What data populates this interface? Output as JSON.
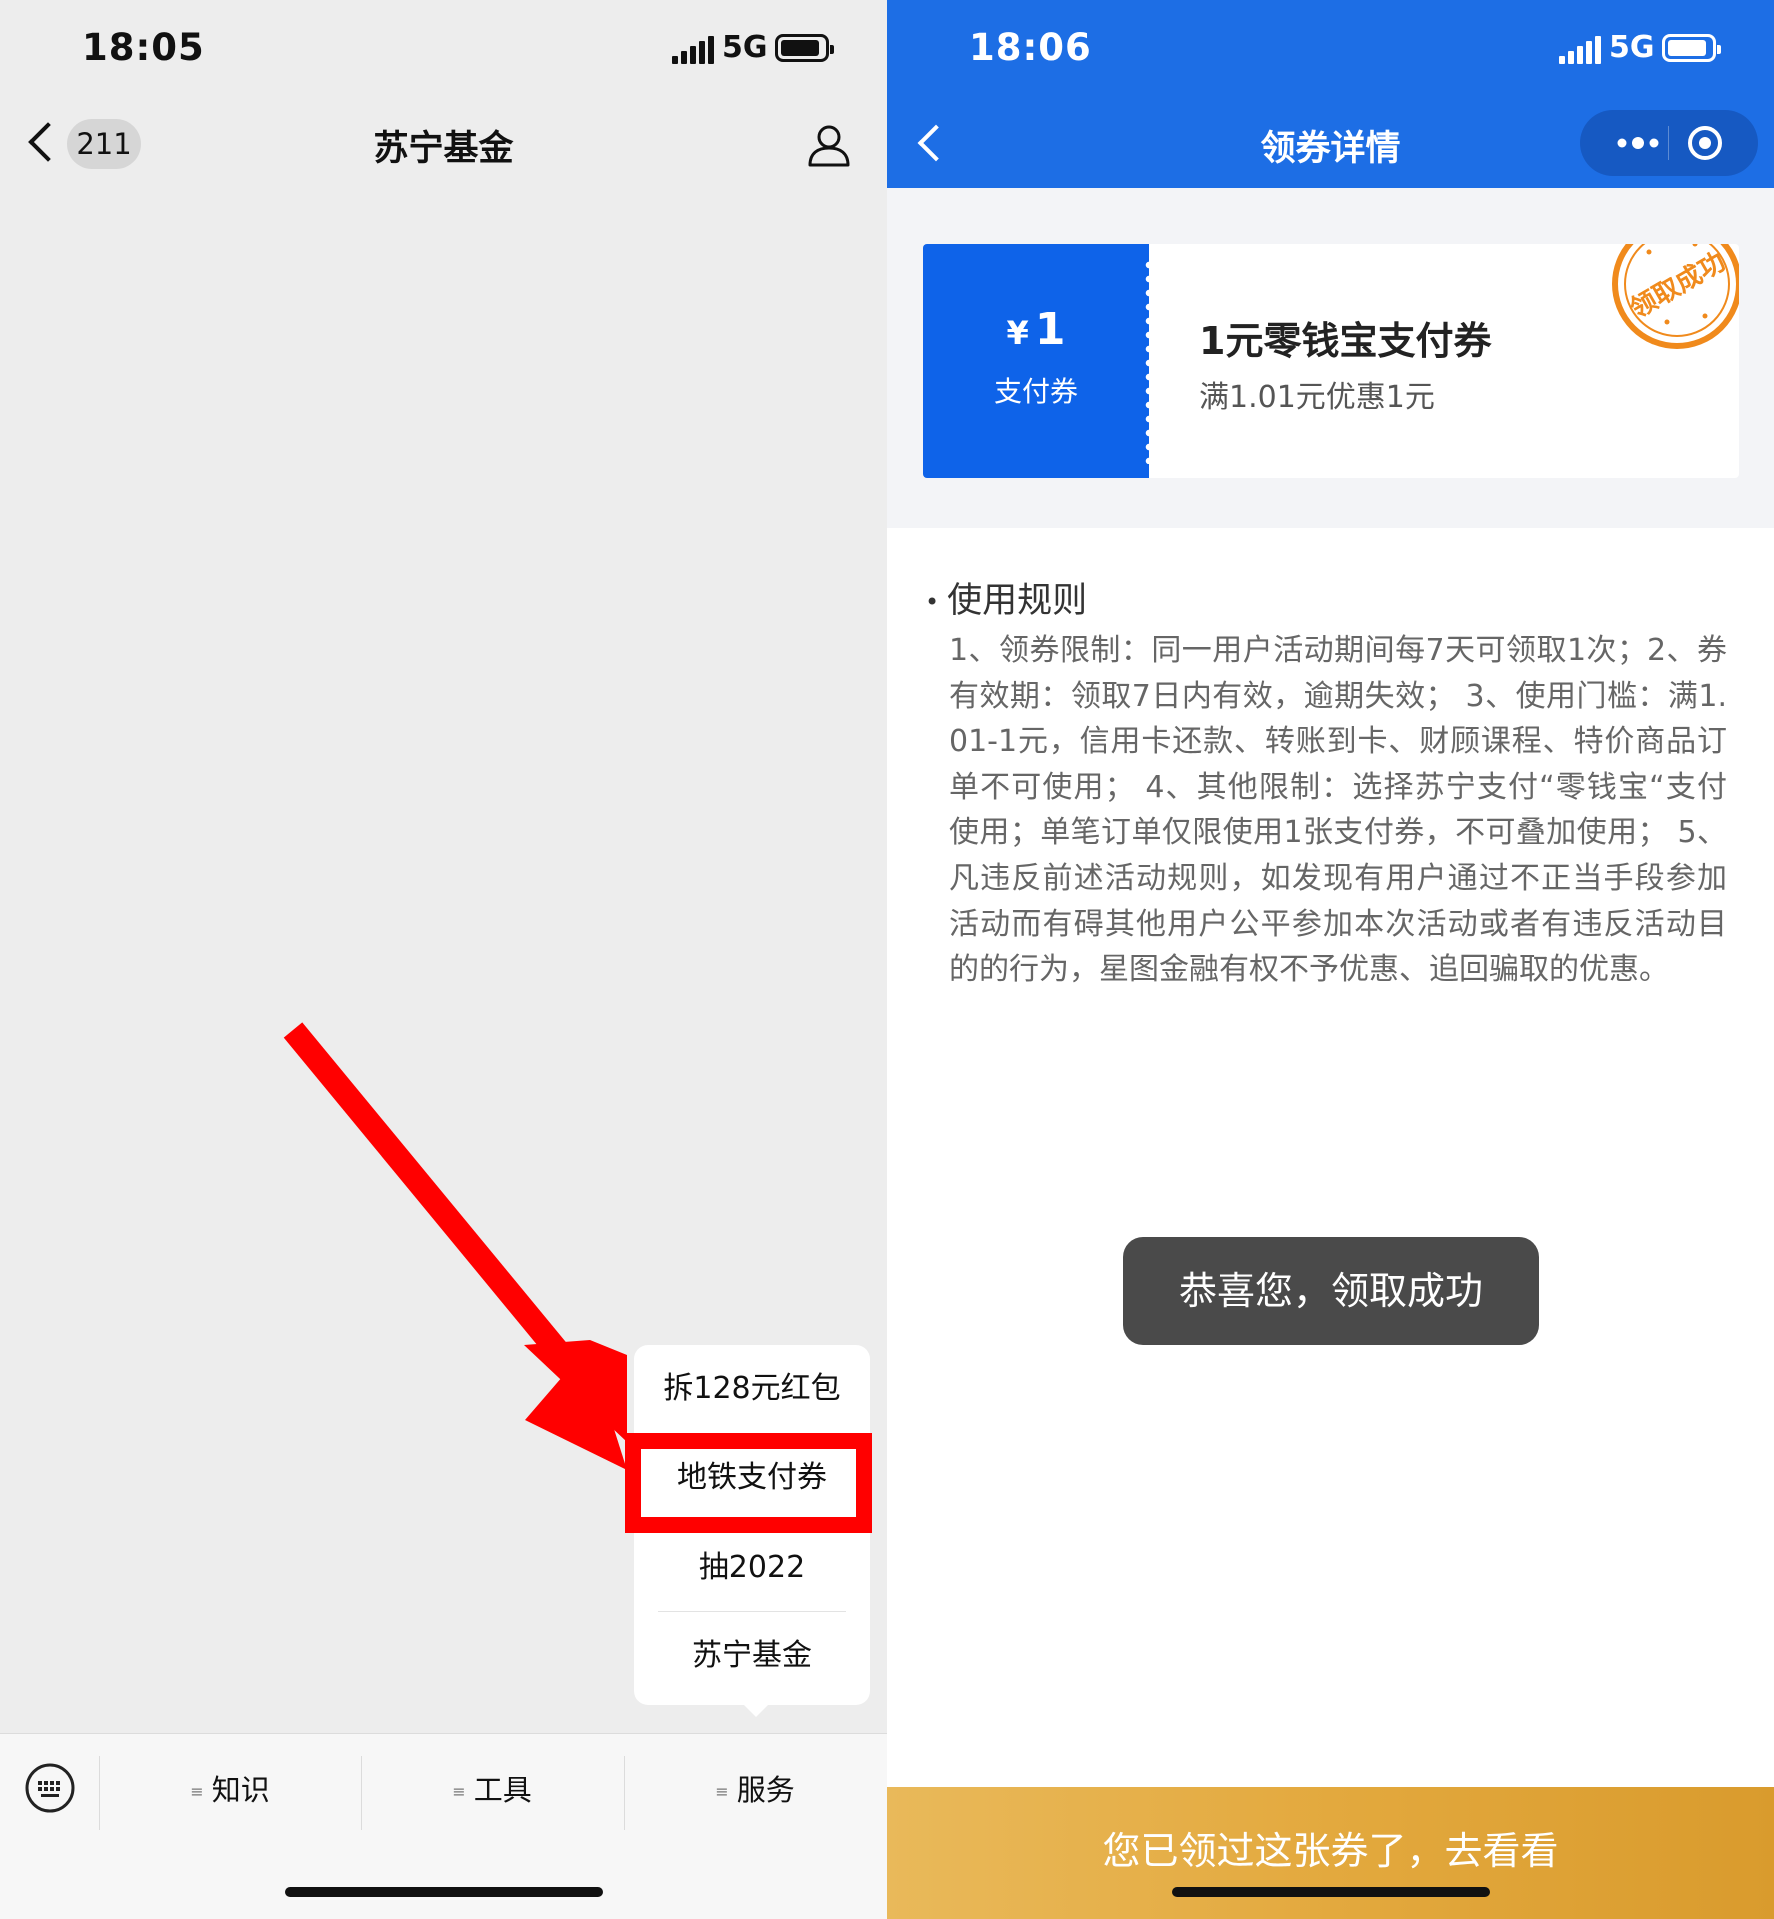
{
  "left": {
    "status": {
      "time": "18:05",
      "network": "5G"
    },
    "nav": {
      "badge_count": "211",
      "title": "苏宁基金"
    },
    "popup_menu": {
      "items": [
        "拆128元红包",
        "地铁支付券",
        "抽2022",
        "苏宁基金"
      ],
      "highlighted_item": "地铁支付券"
    },
    "bottom_menu": {
      "tabs": [
        "知识",
        "工具",
        "服务"
      ]
    },
    "annotation": {
      "arrow_color": "#ff0000",
      "highlight_color": "#ff0000"
    }
  },
  "right": {
    "status": {
      "time": "18:06",
      "network": "5G"
    },
    "nav": {
      "title": "领券详情"
    },
    "coupon": {
      "currency": "¥",
      "amount": "1",
      "type": "支付券",
      "name": "1元零钱宝支付券",
      "condition": "满1.01元优惠1元",
      "stamp_text": "领取成功"
    },
    "rules": {
      "title": "使用规则",
      "text": "1、领券限制：同一用户活动期间每7天可领取1次；2、券有效期：领取7日内有效，逾期失效； 3、使用门槛：满1.01-1元，信用卡还款、转账到卡、财顾课程、特价商品订单不可使用； 4、其他限制：选择苏宁支付“零钱宝“支付使用；单笔订单仅限使用1张支付券，不可叠加使用； 5、凡违反前述活动规则，如发现有用户通过不正当手段参加活动而有碍其他用户公平参加本次活动或者有违反活动目的的行为，星图金融有权不予优惠、追回骗取的优惠。"
    },
    "toast": "恭喜您，领取成功",
    "bottom_button": "您已领过这张券了，去看看",
    "colors": {
      "header_blue": "#1d6ee5",
      "coupon_blue": "#0e63e9",
      "gold": "#e3a93e",
      "stamp_orange": "#f08a1c"
    }
  }
}
